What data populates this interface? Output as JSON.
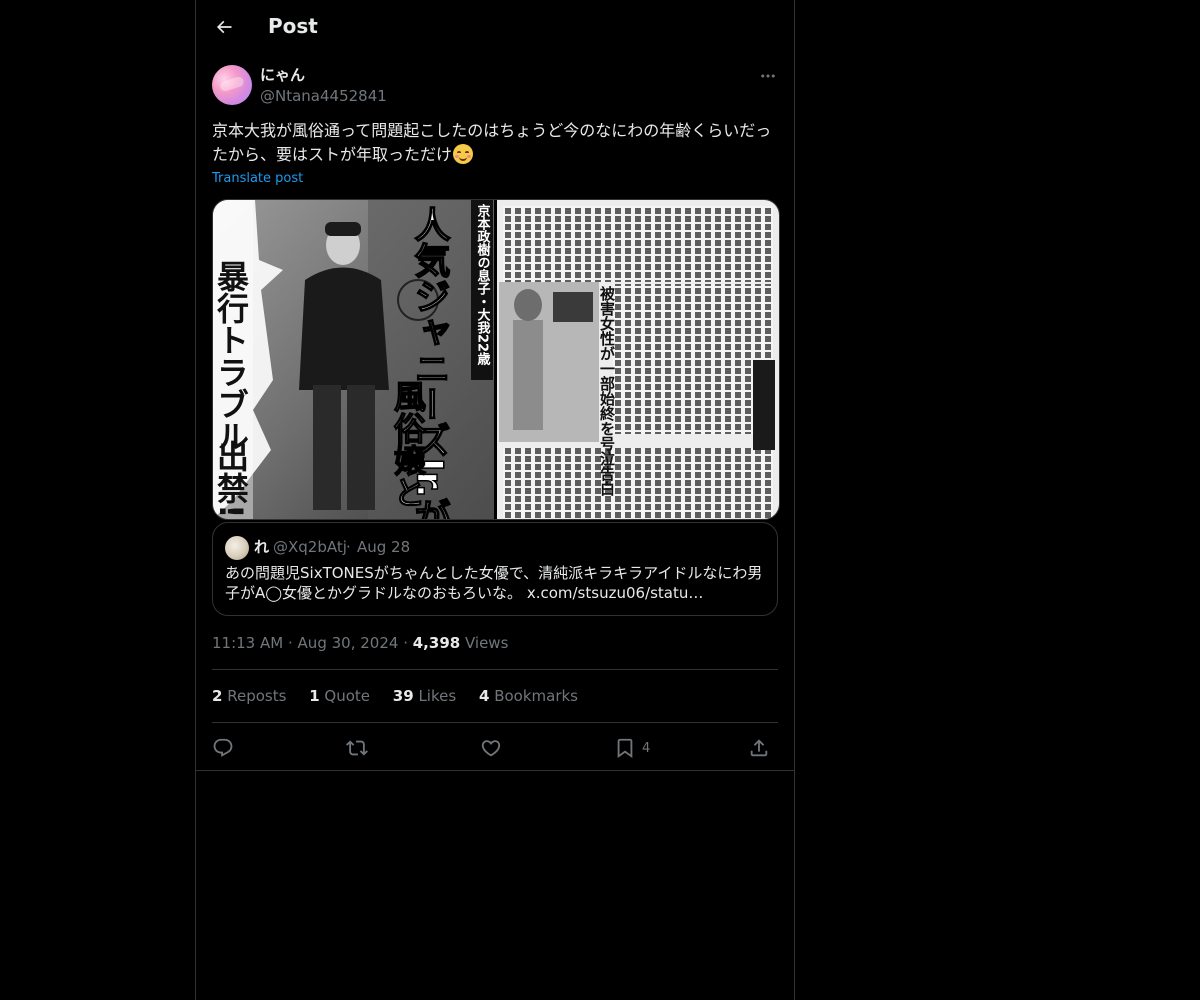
{
  "header": {
    "title": "Post",
    "back_icon": "arrow-left-icon"
  },
  "author": {
    "display_name": "にゃん",
    "handle": "@Ntana4452841",
    "avatar_icon": "avatar-image"
  },
  "post": {
    "text": "京本大我が風俗通って問題起こしたのはちょうど今のなにわの年齢くらいだったから、要はストが年取っただけ",
    "emoji": "relieved-face-emoji",
    "translate_label": "Translate post"
  },
  "media": {
    "left_page_lines": [
      "人気ジャニーズJr.が",
      "風俗嬢と",
      "暴行トラブル",
      "出禁!!",
      "京本政樹の息子・大我22歳"
    ],
    "right_page_line": "被害女性が一部始終を号泣告白"
  },
  "quote": {
    "name": "れ",
    "handle": "@Xq2bAtj",
    "separator": "·",
    "date": "Aug 28",
    "text": "あの問題児SixTONESがちゃんとした女優で、清純派キラキラアイドルなにわ男子がA◯女優とかグラドルなのおもろいな。 x.com/stsuzu06/statu…"
  },
  "meta": {
    "time": "11:13 AM",
    "sep1": "·",
    "date": "Aug 30, 2024",
    "sep2": "·",
    "views_count": "4,398",
    "views_label": "Views"
  },
  "stats": {
    "reposts_count": "2",
    "reposts_label": "Reposts",
    "quotes_count": "1",
    "quotes_label": "Quote",
    "likes_count": "39",
    "likes_label": "Likes",
    "bookmarks_count": "4",
    "bookmarks_label": "Bookmarks"
  },
  "actions": {
    "reply_icon": "reply-icon",
    "repost_icon": "repost-icon",
    "like_icon": "heart-icon",
    "bookmark_icon": "bookmark-icon",
    "bookmark_count": "4",
    "share_icon": "share-icon"
  },
  "colors": {
    "background": "#000000",
    "text": "#e7e9ea",
    "secondary": "#71767b",
    "accent": "#1d9bf0",
    "border": "#2f3336"
  }
}
